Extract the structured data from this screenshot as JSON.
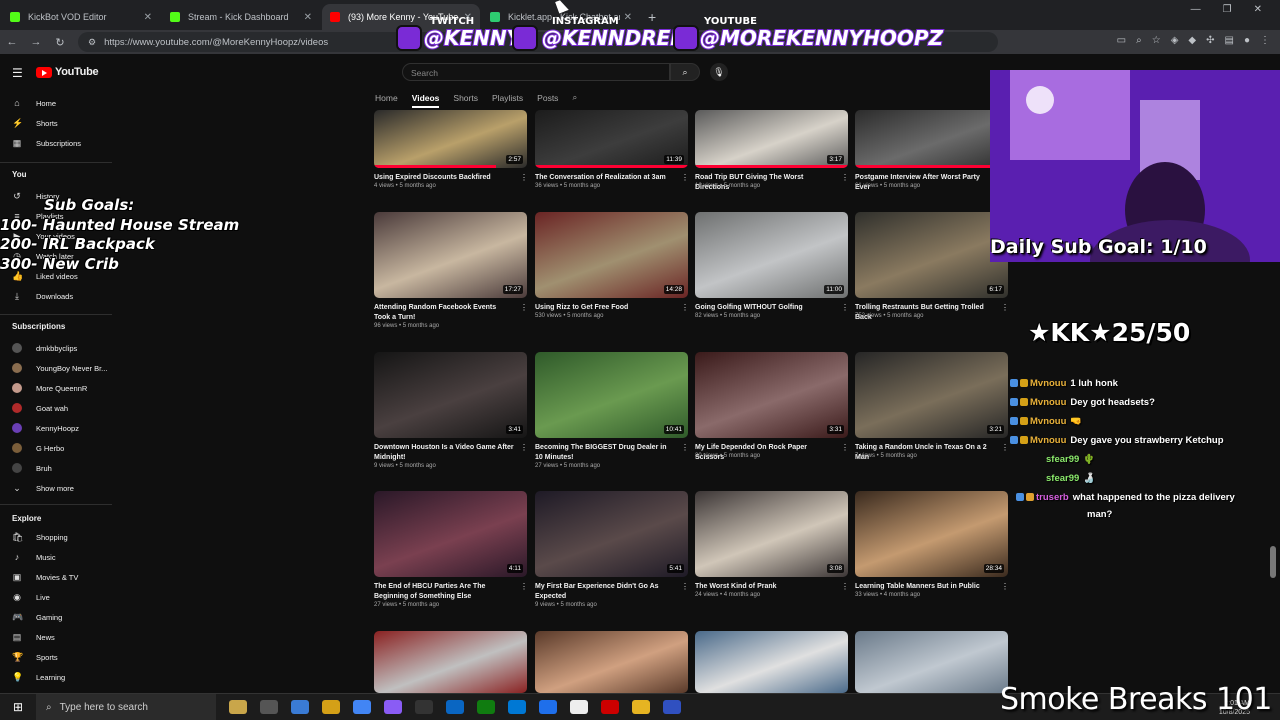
{
  "browser": {
    "tabs": [
      {
        "title": "KickBot VOD Editor",
        "color": "#53fc18",
        "active": false
      },
      {
        "title": "Stream - Kick Dashboard",
        "color": "#53fc18",
        "active": false
      },
      {
        "title": "(93) More Kenny - YouTube",
        "color": "#ff0000",
        "active": true
      },
      {
        "title": "Kicklet.app - Kick Chatbot and...",
        "color": "#2ecc71",
        "active": false
      }
    ],
    "new_tab": "+",
    "url": "https://www.youtube.com/@MoreKennyHoopz/videos"
  },
  "stream_overlay": {
    "twitch_label": "TWITCH",
    "twitch_handle": "@KENNY",
    "instagram_label": "INSTAGRAM",
    "instagram_handle": "@KENNDRELL",
    "youtube_label": "YOUTUBE",
    "youtube_handle": "@MOREKENNYHOOPZ",
    "sub_goals": [
      "Sub Goals:",
      "100- Haunted House Stream",
      "200- IRL Backpack",
      "300- New Crib"
    ],
    "daily_sub_goal": "Daily Sub Goal: 1/10",
    "kk_counter": "★KK★25/50",
    "footer_text": "Smoke Breaks 101"
  },
  "chat": [
    {
      "user": "Mvnouu",
      "color": "#e8b13a",
      "text": "1 luh honk"
    },
    {
      "user": "Mvnouu",
      "color": "#e8b13a",
      "text": "Dey got headsets?"
    },
    {
      "user": "Mvnouu",
      "color": "#e8b13a",
      "text": "🤜"
    },
    {
      "user": "Mvnouu",
      "color": "#e8b13a",
      "text": "Dey gave you strawberry Ketchup"
    },
    {
      "user": "sfear99",
      "color": "#8be96c",
      "text": "🌵"
    },
    {
      "user": "sfear99",
      "color": "#8be96c",
      "text": "🍶"
    },
    {
      "user": "truserb",
      "color": "#d55fde",
      "text": "what happened to the pizza delivery"
    },
    {
      "user": "",
      "color": "#ffffff",
      "text": "man?"
    }
  ],
  "youtube": {
    "logo": "YouTube",
    "search_placeholder": "Search",
    "channel_tabs": [
      "Home",
      "Videos",
      "Shorts",
      "Playlists",
      "Posts"
    ],
    "sidebar": {
      "main": [
        "Home",
        "Shorts",
        "Subscriptions"
      ],
      "you_heading": "You",
      "you_items": [
        "History",
        "Playlists",
        "Your videos",
        "Watch later",
        "Liked videos",
        "Downloads"
      ],
      "subscriptions_heading": "Subscriptions",
      "subscriptions": [
        {
          "name": "dmkbbyclips",
          "color": "#555555"
        },
        {
          "name": "YoungBoy Never Br...",
          "color": "#8a6d4f"
        },
        {
          "name": "More QueennR",
          "color": "#c49a8c"
        },
        {
          "name": "Goat wah",
          "color": "#b02a2a"
        },
        {
          "name": "KennyHoopz",
          "color": "#6a3fb5"
        },
        {
          "name": "G Herbo",
          "color": "#7b5e3a"
        },
        {
          "name": "Bruh",
          "color": "#444444"
        }
      ],
      "show_more": "Show more",
      "explore_heading": "Explore",
      "explore_items": [
        "Shopping",
        "Music",
        "Movies & TV",
        "Live",
        "Gaming",
        "News",
        "Sports",
        "Learning"
      ]
    },
    "videos": [
      {
        "title": "Using Expired Discounts Backfired",
        "meta": "4 views • 5 months ago",
        "duration": "2:57",
        "progress": 0.8
      },
      {
        "title": "The Conversation of Realization at 3am",
        "meta": "36 views • 5 months ago",
        "duration": "11:39",
        "progress": 1
      },
      {
        "title": "Road Trip BUT Giving The Worst Directions",
        "meta": "16 views • 5 months ago",
        "duration": "3:17",
        "progress": 1
      },
      {
        "title": "Postgame Interview After Worst Party Ever",
        "meta": "61 views • 5 months ago",
        "duration": "",
        "progress": 1
      },
      {
        "title": "Attending Random Facebook Events Took a Turn!",
        "meta": "96 views • 5 months ago",
        "duration": "17:27",
        "progress": 0
      },
      {
        "title": "Using Rizz to Get Free Food",
        "meta": "530 views • 5 months ago",
        "duration": "14:28",
        "progress": 0
      },
      {
        "title": "Going Golfing WITHOUT Golfing",
        "meta": "82 views • 5 months ago",
        "duration": "11:00",
        "progress": 0
      },
      {
        "title": "Trolling Restraunts But Getting Trolled Back",
        "meta": "752 views • 5 months ago",
        "duration": "6:17",
        "progress": 0
      },
      {
        "title": "Downtown Houston Is a Video Game After Midnight!",
        "meta": "9 views • 5 months ago",
        "duration": "3:41",
        "progress": 0
      },
      {
        "title": "Becoming The BIGGEST Drug Dealer in 10 Minutes!",
        "meta": "27 views • 5 months ago",
        "duration": "10:41",
        "progress": 0
      },
      {
        "title": "My Life Depended On Rock Paper Scissors",
        "meta": "30 views • 5 months ago",
        "duration": "3:31",
        "progress": 0
      },
      {
        "title": "Taking a Random Uncle in Texas On a 2 Man",
        "meta": "7 views • 5 months ago",
        "duration": "3:21",
        "progress": 0
      },
      {
        "title": "The End of HBCU Parties Are The Beginning of Something Else",
        "meta": "27 views • 5 months ago",
        "duration": "4:11",
        "progress": 0
      },
      {
        "title": "My First Bar Experience Didn't Go As Expected",
        "meta": "9 views • 5 months ago",
        "duration": "5:41",
        "progress": 0
      },
      {
        "title": "The Worst Kind of Prank",
        "meta": "24 views • 4 months ago",
        "duration": "3:08",
        "progress": 0
      },
      {
        "title": "Learning Table Manners But in Public",
        "meta": "33 views • 4 months ago",
        "duration": "28:34",
        "progress": 0
      },
      {
        "title": "",
        "meta": "",
        "duration": "",
        "progress": 0
      },
      {
        "title": "",
        "meta": "",
        "duration": "",
        "progress": 0
      },
      {
        "title": "",
        "meta": "",
        "duration": "",
        "progress": 0
      },
      {
        "title": "",
        "meta": "",
        "duration": "",
        "progress": 0
      }
    ]
  },
  "taskbar": {
    "search_placeholder": "Type here to search",
    "time": "2:01 AM",
    "date": "10/8/2025"
  }
}
